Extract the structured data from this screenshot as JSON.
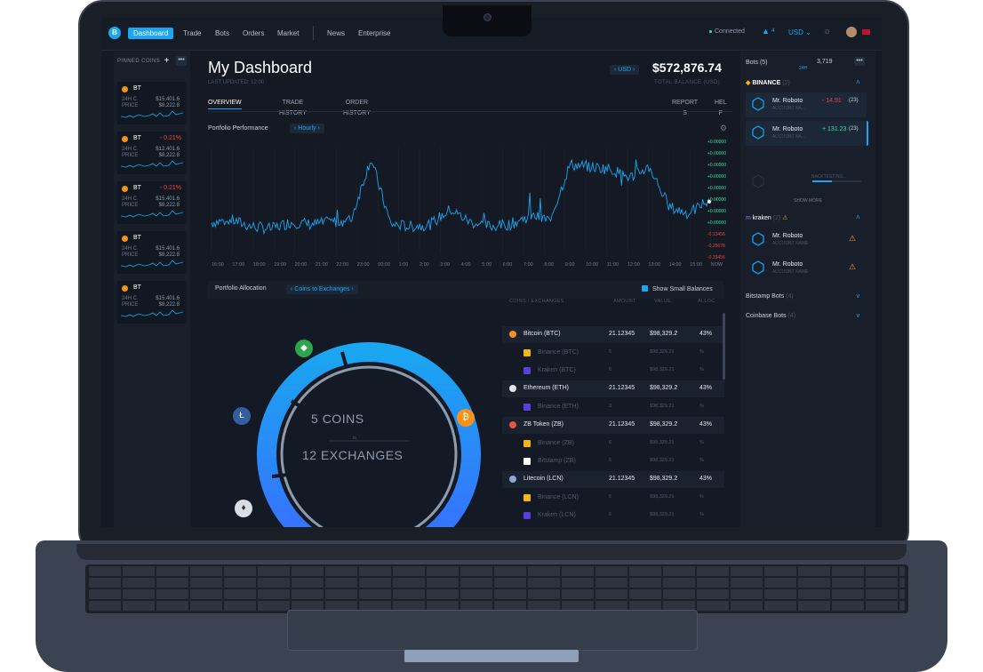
{
  "topbar": {
    "logo": "B",
    "nav": [
      "Dashboard",
      "Trade",
      "Bots",
      "Orders",
      "Market",
      "News",
      "Enterprise"
    ],
    "status": "Connected",
    "bell_count": "4",
    "currency": "USD"
  },
  "pinned": {
    "title": "PINNED COINS",
    "cards": [
      {
        "symbol": "BT",
        "change": "",
        "l1": "24H C",
        "l2": "PRICE",
        "v1": "$15,401.6",
        "v2": "$8,222.8"
      },
      {
        "symbol": "BT",
        "change": "- 0.21%",
        "l1": "24H C",
        "l2": "PRICE",
        "v1": "$12,401.6",
        "v2": "$8,222.8"
      },
      {
        "symbol": "BT",
        "change": "- 0.21%",
        "l1": "24H C",
        "l2": "PRICE",
        "v1": "$15,401.6",
        "v2": "$8,222.8"
      },
      {
        "symbol": "BT",
        "change": "",
        "l1": "24H C",
        "l2": "PRICE",
        "v1": "$15,401.6",
        "v2": "$8,222.8"
      },
      {
        "symbol": "BT",
        "change": "",
        "l1": "24H C",
        "l2": "PRICE",
        "v1": "$15,401.6",
        "v2": "$8,222.8"
      }
    ]
  },
  "main": {
    "title": "My Dashboard",
    "subtitle": "LAST UPDATED: 12:00",
    "currency_pill": "USD",
    "balance": "$572,876.74",
    "balance_label": "TOTAL BALANCE (USD)",
    "tabs": [
      {
        "l1": "OVERVIEW",
        "l2": ""
      },
      {
        "l1": "TRADE",
        "l2": "HISTORY"
      },
      {
        "l1": "ORDER",
        "l2": "HISTORY"
      },
      {
        "l1": "REPORT",
        "l2": "S"
      },
      {
        "l1": "HEL",
        "l2": "P"
      }
    ],
    "perf_label": "Portfolio Performance",
    "perf_interval": "Hourly",
    "alloc_label": "Portfolio Allocation",
    "alloc_mode": "Coins to Exchanges",
    "show_small": "Show Small Balances",
    "coins_number": "5",
    "coins_word": "COINS",
    "ring_to": "to",
    "exch_number": "12",
    "exch_word": "EXCHANGES"
  },
  "chart_data": {
    "type": "line",
    "title": "Portfolio Performance",
    "x": [
      "16:00",
      "17:00",
      "18:00",
      "19:00",
      "20:00",
      "21:00",
      "22:00",
      "23:00",
      "00:00",
      "1:00",
      "2:00",
      "3:00",
      "4:00",
      "5:00",
      "6:00",
      "7:00",
      "8:00",
      "9:00",
      "10:00",
      "11:00",
      "12:00",
      "13:00",
      "14:00",
      "15:00",
      "NOW"
    ],
    "y_ticks": [
      "+4.00%",
      "+3.50%",
      "+3.00%",
      "+2.50%",
      "+2.00%",
      "+1.50%",
      "+1.00%",
      "+0.50%",
      "0",
      "-0.50%",
      "-1.00%"
    ],
    "y_labels": [
      "+0.00000",
      "+0.00000",
      "+0.00000",
      "+0.00000",
      "+0.00000",
      "+0.00000",
      "+0.00000",
      "+0.00000",
      "-0.13456",
      "-0.25678",
      "-0.33456"
    ],
    "series": [
      {
        "values": [
          0.5,
          0.6,
          0.3,
          0.2,
          0.5,
          0.4,
          0.5,
          0.6,
          3.5,
          0.4,
          0.3,
          0.4,
          1.1,
          0.5,
          0.3,
          0.4,
          0.8,
          0.6,
          3.2,
          3.1,
          3.0,
          2.6,
          3.1,
          1.2,
          0.9,
          1.6
        ]
      }
    ]
  },
  "allocation_table": {
    "headers": [
      "COINS / EXCHANGES",
      "AMOUNT",
      "VALUE",
      "ALLOC."
    ],
    "rows": [
      {
        "kind": "parent",
        "name": "Bitcoin (BTC)",
        "amount": "21.12345",
        "value": "$98,329.2",
        "pct": "43%",
        "color": "#f7931a"
      },
      {
        "kind": "child",
        "name": "Binance (BTC)",
        "amount": "6",
        "value": "$98,329.21",
        "pct": "%",
        "color": "#f0b90b"
      },
      {
        "kind": "child",
        "name": "Kraken (BTC)",
        "amount": "6",
        "value": "$98,329.21",
        "pct": "%",
        "color": "#5741d9"
      },
      {
        "kind": "parent",
        "name": "Ethereum (ETH)",
        "amount": "21.12345",
        "value": "$98,329.2",
        "pct": "43%",
        "color": "#e3e8ef"
      },
      {
        "kind": "child",
        "name": "Binance (ETH)",
        "amount": "3",
        "value": "$98,329.21",
        "pct": "%",
        "color": "#5741d9"
      },
      {
        "kind": "parent",
        "name": "ZB Token (ZB)",
        "amount": "21.12345",
        "value": "$98,329.2",
        "pct": "43%",
        "color": "#e5534b"
      },
      {
        "kind": "child",
        "name": "Binance (ZB)",
        "amount": "6",
        "value": "$98,329.21",
        "pct": "%",
        "color": "#f0b90b"
      },
      {
        "kind": "child",
        "name": "Bitstamp (ZB)",
        "amount": "6",
        "value": "$98,329.21",
        "pct": "%",
        "color": "#ffffff"
      },
      {
        "kind": "parent",
        "name": "Litecoin (LCN)",
        "amount": "21.12345",
        "value": "$98,329.2",
        "pct": "43%",
        "color": "#8ea7d4"
      },
      {
        "kind": "child",
        "name": "Binance (LCN)",
        "amount": "6",
        "value": "$98,329.21",
        "pct": "%",
        "color": "#f0b90b"
      },
      {
        "kind": "child",
        "name": "Kraken (LCN)",
        "amount": "6",
        "value": "$98,329.21",
        "pct": "%",
        "color": "#5741d9"
      },
      {
        "kind": "child",
        "name": "Bitstamp (LCN)",
        "amount": "6",
        "value": "$98,329.21",
        "pct": "%",
        "color": "#ffffff"
      }
    ]
  },
  "bots": {
    "title": "Bots (5)",
    "period": "24H",
    "total": "3,719",
    "binance": {
      "name": "BINANCE",
      "count": "(2)"
    },
    "kraken": {
      "name": "kraken",
      "count": "(2)"
    },
    "bot_cards": [
      {
        "name": "Mr. Roboto",
        "sub": "ACCOUNT NA...",
        "num": "- 14.91",
        "right": "(23)",
        "num_color": "#f0453a"
      },
      {
        "name": "Mr. Roboto",
        "sub": "ACCOUNT NA...",
        "num": "+ 131.23",
        "right": "(23)",
        "num_color": "#2ee59d"
      },
      {
        "name": "Mr. Roboto",
        "sub": "ACCOUNT NAME",
        "num": "",
        "right": "",
        "num_color": "#c8d0dc"
      },
      {
        "name": "Mr. Roboto",
        "sub": "ACCOUNT NAME",
        "num": "",
        "right": "",
        "num_color": "#c8d0dc"
      }
    ],
    "backtesting": "BACKTESTING...",
    "show_more": "SHOW MORE",
    "bitstamp": {
      "name": "Bitstamp Bots",
      "count": "(4)"
    },
    "coinbase": {
      "name": "Coinbase Bots",
      "count": "(4)"
    }
  }
}
